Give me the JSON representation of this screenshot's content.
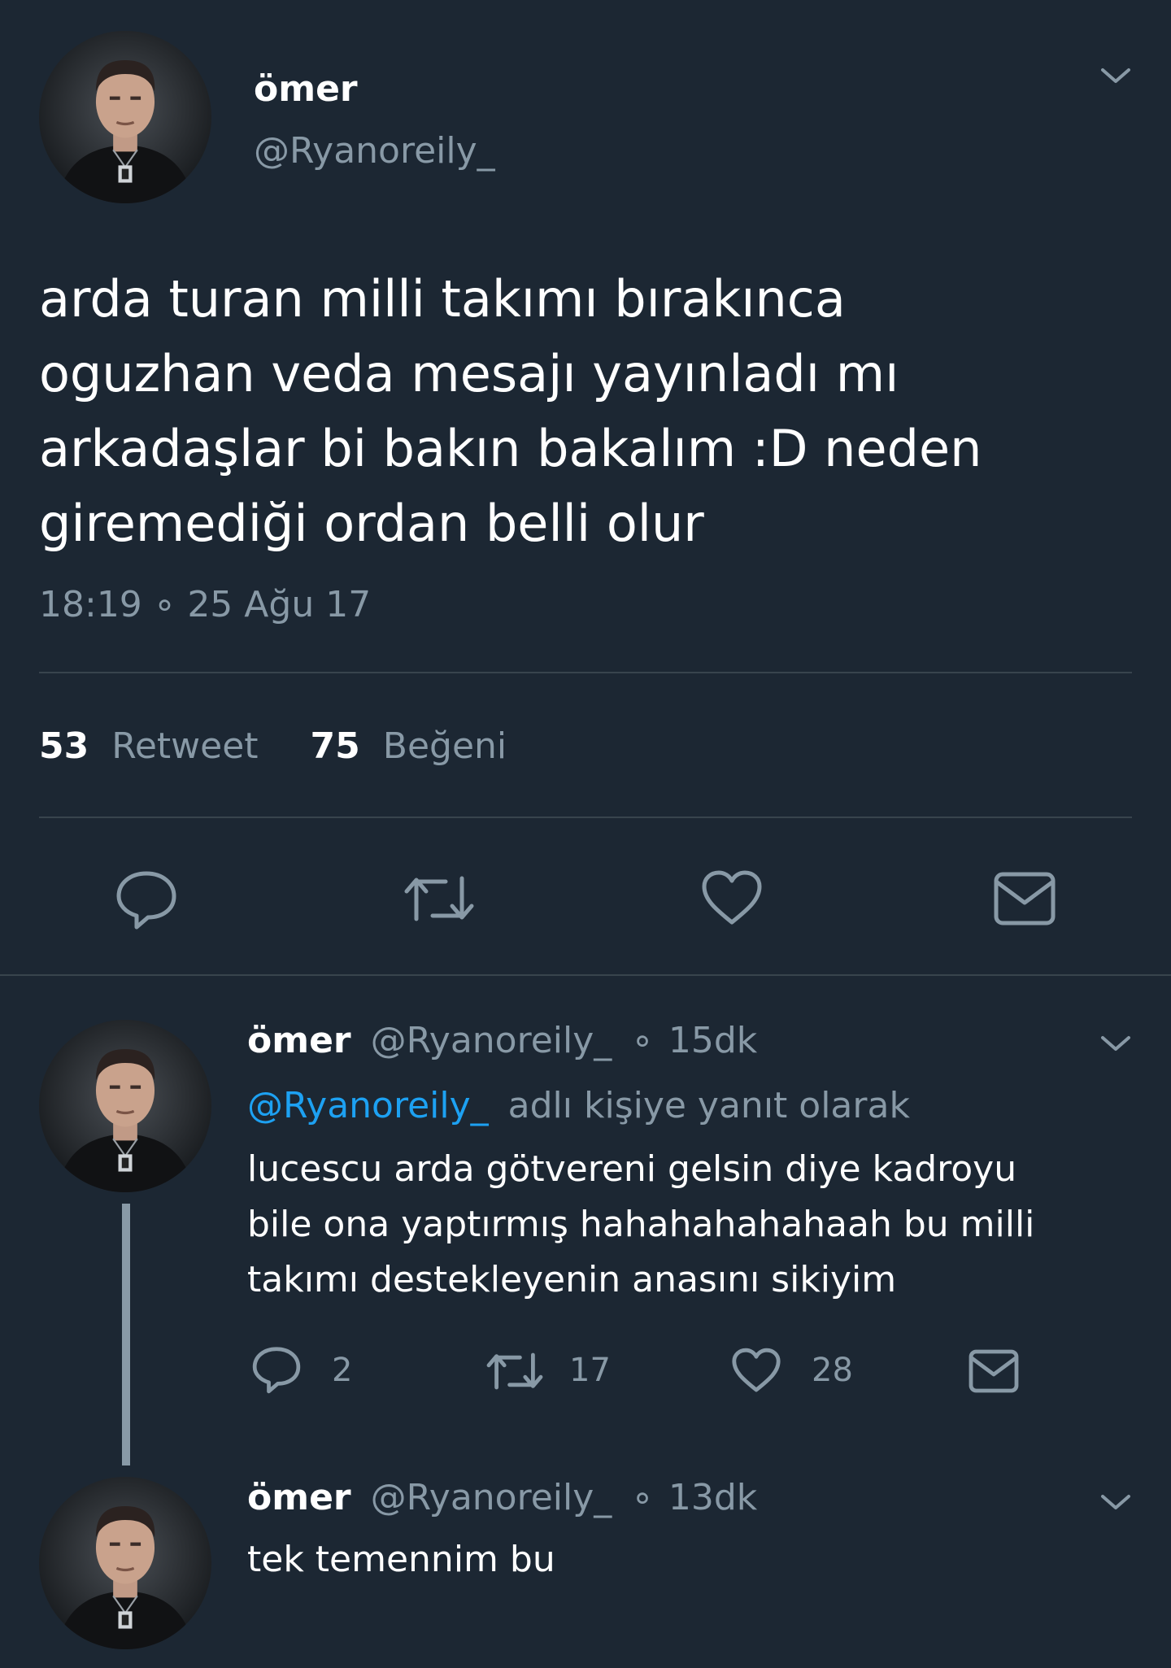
{
  "main_tweet": {
    "display_name": "ömer",
    "handle": "@Ryanoreily_",
    "text_lines": [
      "arda turan milli takımı bırakınca",
      "oguzhan veda mesajı yayınladı mı",
      "arkadaşlar bi bakın bakalım :D neden",
      "giremediği ordan belli olur"
    ],
    "timestamp": "18:19 ∘ 25 Ağu 17",
    "retweet_count": "53",
    "retweet_label": "Retweet",
    "like_count": "75",
    "like_label": "Beğeni",
    "actions": [
      "reply-icon",
      "retweet-icon",
      "like-icon",
      "message-icon"
    ]
  },
  "replies": [
    {
      "display_name": "ömer",
      "handle": "@Ryanoreily_",
      "dot": "∘",
      "time": "15dk",
      "reply_to_handle": "@Ryanoreily_",
      "reply_to_suffix": "adlı kişiye yanıt olarak",
      "text_lines": [
        "lucescu arda götvereni gelsin diye kadroyu",
        "bile ona yaptırmış hahahahahahaah bu milli",
        "takımı destekleyenin anasını sikiyim"
      ],
      "reply_count": "2",
      "retweet_count": "17",
      "like_count": "28"
    },
    {
      "display_name": "ömer",
      "handle": "@Ryanoreily_",
      "dot": "∘",
      "time": "13dk",
      "text_lines": [
        "tek temennim bu"
      ]
    }
  ],
  "colors": {
    "background": "#1c2733",
    "text": "#ffffff",
    "muted": "#8899a6",
    "link": "#1da1f2",
    "divider": "#38444d"
  }
}
